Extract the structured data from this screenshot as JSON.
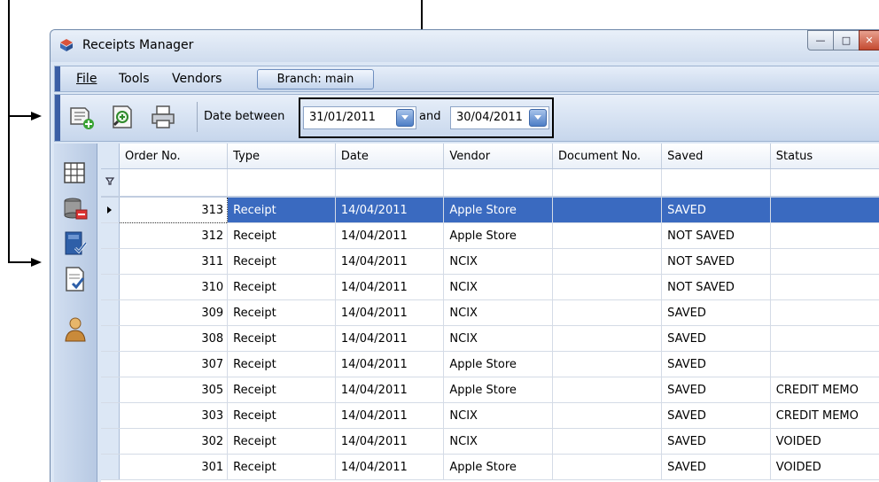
{
  "window": {
    "title": "Receipts Manager",
    "accent": "#3a6ac0",
    "controls": {
      "minimize": "—",
      "maximize": "□",
      "close": "✕"
    }
  },
  "menu": {
    "items": [
      "File",
      "Tools",
      "Vendors"
    ],
    "branch_label": "Branch: main"
  },
  "toolbar": {
    "icons": [
      "new-receipt-icon",
      "search-zoom-icon",
      "print-icon"
    ],
    "date_between_label": "Date between",
    "date_from": "31/01/2011",
    "and_label": "and",
    "date_to": "30/04/2011"
  },
  "sidenav": {
    "icons": [
      "grid-view-icon",
      "database-export-icon",
      "book-check-icon",
      "document-check-icon",
      "user-icon"
    ]
  },
  "grid": {
    "columns": [
      "Order No.",
      "Type",
      "Date",
      "Vendor",
      "Document No.",
      "Saved",
      "Status"
    ],
    "selected_row": 0,
    "rows": [
      {
        "order": "313",
        "type": "Receipt",
        "date": "14/04/2011",
        "vendor": "Apple Store",
        "doc": "",
        "saved": "SAVED",
        "status": ""
      },
      {
        "order": "312",
        "type": "Receipt",
        "date": "14/04/2011",
        "vendor": "Apple Store",
        "doc": "",
        "saved": "NOT SAVED",
        "status": ""
      },
      {
        "order": "311",
        "type": "Receipt",
        "date": "14/04/2011",
        "vendor": "NCIX",
        "doc": "",
        "saved": "NOT SAVED",
        "status": ""
      },
      {
        "order": "310",
        "type": "Receipt",
        "date": "14/04/2011",
        "vendor": "NCIX",
        "doc": "",
        "saved": "NOT SAVED",
        "status": ""
      },
      {
        "order": "309",
        "type": "Receipt",
        "date": "14/04/2011",
        "vendor": "NCIX",
        "doc": "",
        "saved": "SAVED",
        "status": ""
      },
      {
        "order": "308",
        "type": "Receipt",
        "date": "14/04/2011",
        "vendor": "NCIX",
        "doc": "",
        "saved": "SAVED",
        "status": ""
      },
      {
        "order": "307",
        "type": "Receipt",
        "date": "14/04/2011",
        "vendor": "Apple Store",
        "doc": "",
        "saved": "SAVED",
        "status": ""
      },
      {
        "order": "305",
        "type": "Receipt",
        "date": "14/04/2011",
        "vendor": "Apple Store",
        "doc": "",
        "saved": "SAVED",
        "status": "CREDIT MEMO"
      },
      {
        "order": "303",
        "type": "Receipt",
        "date": "14/04/2011",
        "vendor": "NCIX",
        "doc": "",
        "saved": "SAVED",
        "status": "CREDIT MEMO"
      },
      {
        "order": "302",
        "type": "Receipt",
        "date": "14/04/2011",
        "vendor": "NCIX",
        "doc": "",
        "saved": "SAVED",
        "status": "VOIDED"
      },
      {
        "order": "301",
        "type": "Receipt",
        "date": "14/04/2011",
        "vendor": "Apple Store",
        "doc": "",
        "saved": "SAVED",
        "status": "VOIDED"
      }
    ]
  }
}
